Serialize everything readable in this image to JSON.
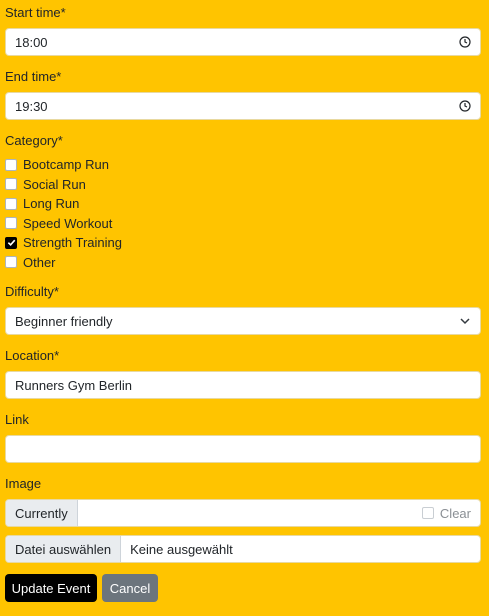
{
  "start_time": {
    "label": "Start time*",
    "value": "18:00",
    "icon": "clock-icon"
  },
  "end_time": {
    "label": "End time*",
    "value": "19:30",
    "icon": "clock-icon"
  },
  "category": {
    "label": "Category*",
    "options": [
      {
        "label": "Bootcamp Run",
        "checked": false
      },
      {
        "label": "Social Run",
        "checked": false
      },
      {
        "label": "Long Run",
        "checked": false
      },
      {
        "label": "Speed Workout",
        "checked": false
      },
      {
        "label": "Strength Training",
        "checked": true
      },
      {
        "label": "Other",
        "checked": false
      }
    ]
  },
  "difficulty": {
    "label": "Difficulty*",
    "value": "Beginner friendly",
    "icon": "chevron-down-icon"
  },
  "location": {
    "label": "Location*",
    "value": "Runners Gym Berlin"
  },
  "link": {
    "label": "Link",
    "value": ""
  },
  "image": {
    "label": "Image",
    "currently_label": "Currently",
    "clear_label": "Clear",
    "clear_checked": false,
    "file_button": "Datei auswählen",
    "file_status": "Keine ausgewählt"
  },
  "actions": {
    "update": "Update Event",
    "cancel": "Cancel"
  },
  "colors": {
    "page_bg": "#ffc400",
    "primary_button": "#000000",
    "secondary_button": "#6c757d"
  }
}
